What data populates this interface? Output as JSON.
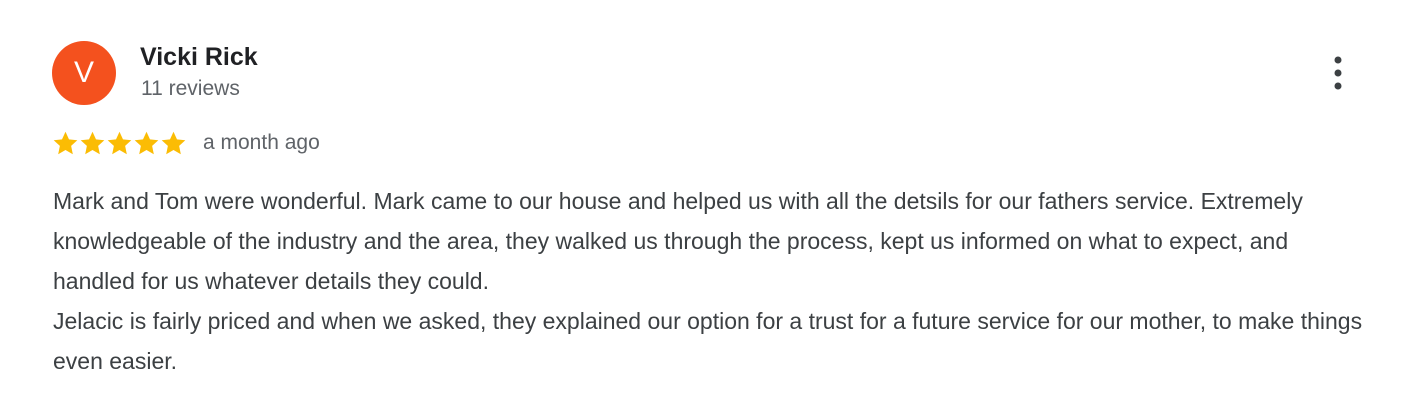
{
  "reviewer": {
    "initial": "V",
    "name": "Vicki Rick",
    "reviews_count": "11 reviews",
    "avatar_color": "#f4511e"
  },
  "menu": {
    "icon": "more-vert-icon"
  },
  "rating": {
    "stars": 5,
    "max_stars": 5,
    "star_color": "#fbbc04",
    "date": "a month ago"
  },
  "review": {
    "paragraphs": [
      "Mark and Tom were wonderful. Mark came to our house and helped us with all the detsils for our fathers service. Extremely knowledgeable of the industry and the area, they walked us through the process, kept us informed on what to expect, and handled for us whatever details they could.",
      "Jelacic is fairly priced and when we asked, they explained our option for a trust for a future service for our mother, to make things even easier."
    ]
  }
}
